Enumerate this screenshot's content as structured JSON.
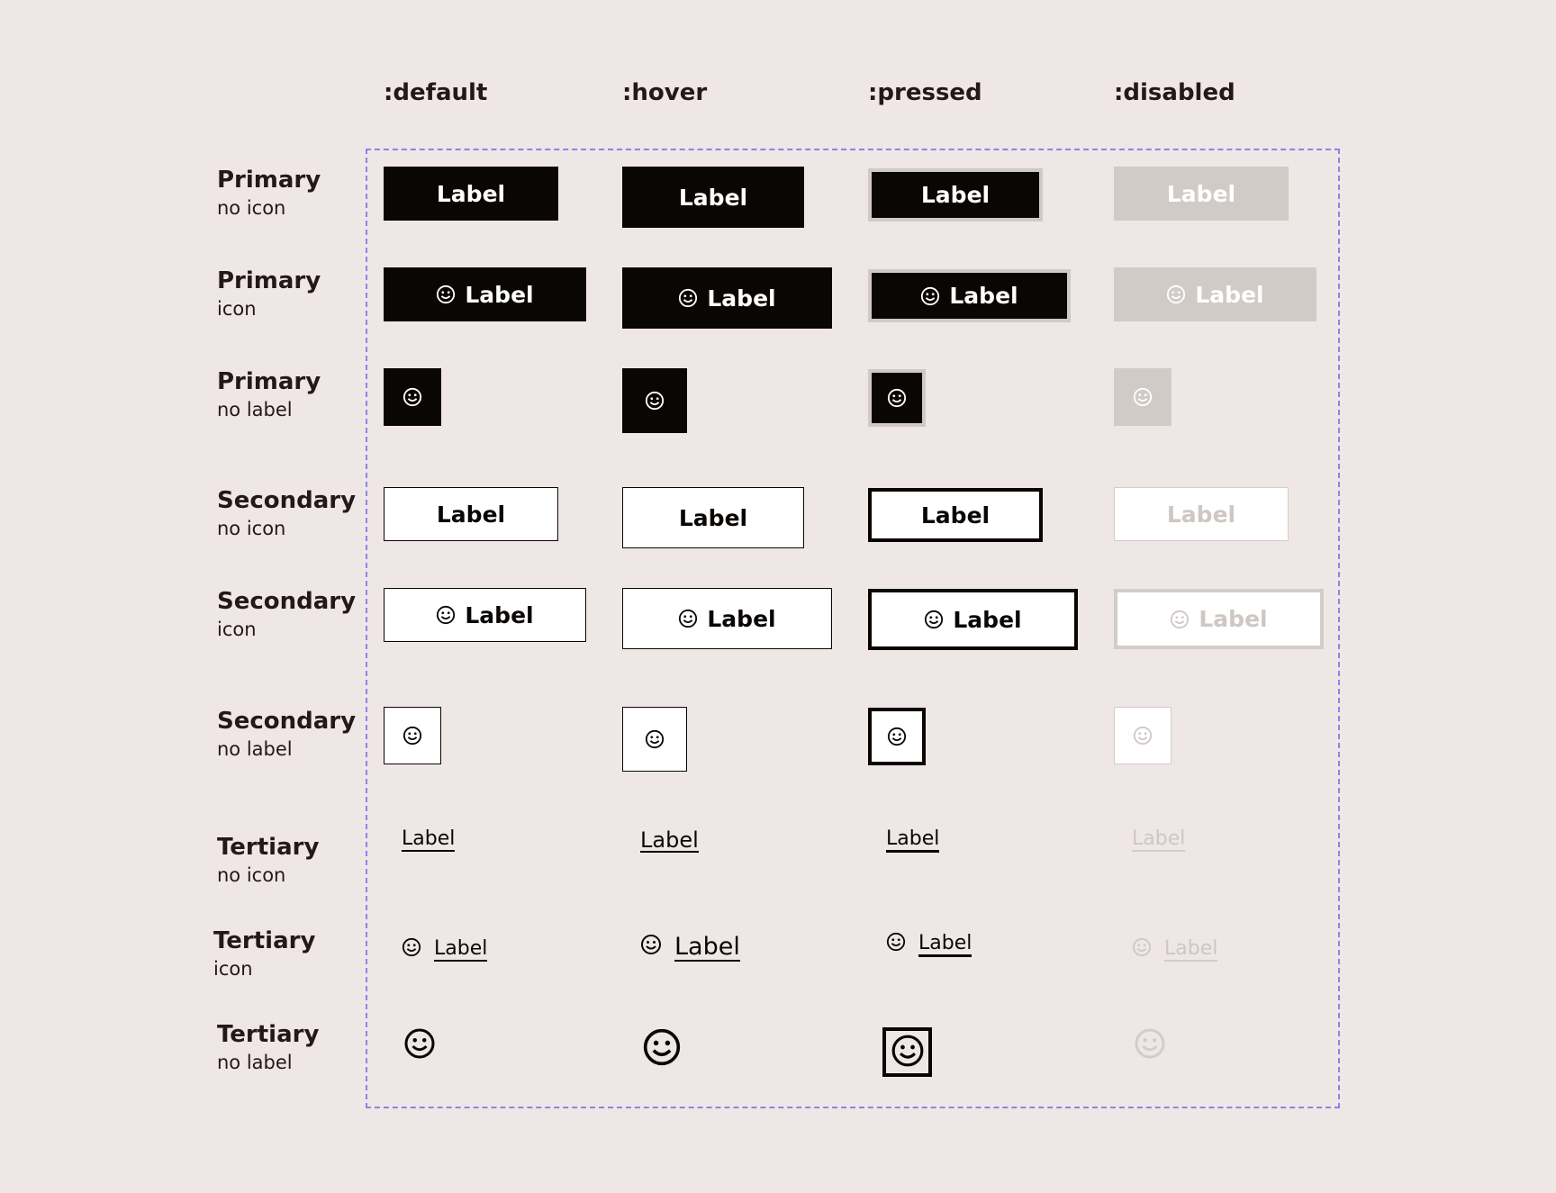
{
  "columns": [
    ":default",
    ":hover",
    ":pressed",
    ":disabled"
  ],
  "rows": [
    {
      "title": "Primary",
      "subtitle": "no icon"
    },
    {
      "title": "Primary",
      "subtitle": "icon"
    },
    {
      "title": "Primary",
      "subtitle": "no label"
    },
    {
      "title": "Secondary",
      "subtitle": "no icon"
    },
    {
      "title": "Secondary",
      "subtitle": "icon"
    },
    {
      "title": "Secondary",
      "subtitle": "no label"
    },
    {
      "title": "Tertiary",
      "subtitle": "no icon"
    },
    {
      "title": "Tertiary",
      "subtitle": "icon"
    },
    {
      "title": "Tertiary",
      "subtitle": "no label"
    }
  ],
  "button_label": "Label",
  "icon": "smiley-icon",
  "colors": {
    "background": "#efe7e6",
    "primary": "#0a0603",
    "disabled_fill": "#d1cbc8",
    "disabled_text": "#cfc7c4",
    "pressed_outline": "#cfcac6",
    "frame_dash": "#8d83e6"
  }
}
